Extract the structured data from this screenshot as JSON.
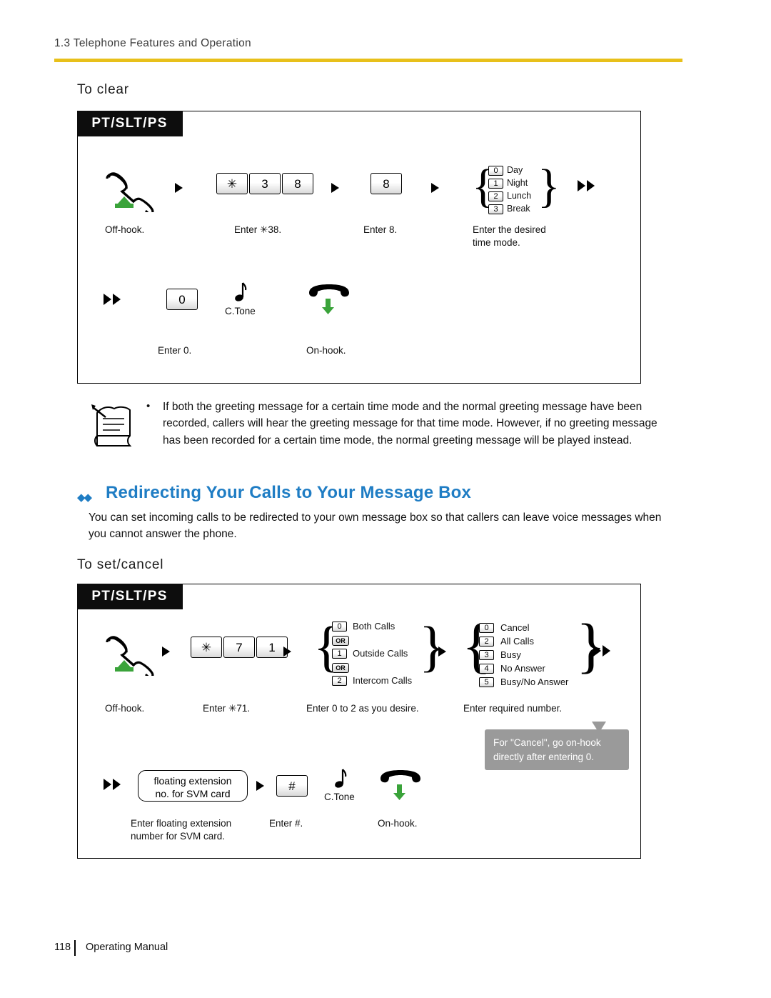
{
  "header": {
    "section": "1.3 Telephone Features and Operation"
  },
  "footer": {
    "page_number": "118",
    "doc_title": "Operating Manual"
  },
  "section1": {
    "heading": "To clear",
    "tab_label": "PT/SLT/PS",
    "steps": [
      {
        "caption": "Off-hook."
      },
      {
        "keys": [
          "✳",
          "3",
          "8"
        ],
        "caption": "Enter ✳38."
      },
      {
        "keys": [
          "8"
        ],
        "caption": "Enter 8."
      },
      {
        "caption": "Enter the desired\ntime mode."
      },
      {
        "keys": [
          "0"
        ],
        "caption": "Enter 0."
      },
      {
        "caption": "On-hook."
      }
    ],
    "time_modes": [
      {
        "key": "0",
        "label": "Day"
      },
      {
        "key": "1",
        "label": "Night"
      },
      {
        "key": "2",
        "label": "Lunch"
      },
      {
        "key": "3",
        "label": "Break"
      }
    ],
    "ctone_label": "C.Tone"
  },
  "note": {
    "bullet": "•",
    "text": "If both the greeting message for a certain time mode and the normal greeting message have been recorded, callers will hear the greeting message for that time mode. However, if no greeting message has been recorded for a certain time mode, the normal greeting message will be played instead."
  },
  "feature": {
    "diamonds": "◆◆",
    "title": "Redirecting Your Calls to Your Message Box",
    "description": "You can set incoming calls to be redirected to your own message box so that callers can leave voice messages when you cannot answer the phone."
  },
  "section2": {
    "heading": "To set/cancel",
    "tab_label": "PT/SLT/PS",
    "steps": [
      {
        "caption": "Off-hook."
      },
      {
        "keys": [
          "✳",
          "7",
          "1"
        ],
        "caption": "Enter ✳71."
      },
      {
        "caption": "Enter 0 to 2 as you desire."
      },
      {
        "caption": "Enter required number."
      },
      {
        "caption": "Enter floating extension\nnumber for SVM card."
      },
      {
        "keys": [
          "#"
        ],
        "caption": "Enter #."
      },
      {
        "caption": "On-hook."
      }
    ],
    "call_types": [
      {
        "key": "0",
        "label": "Both Calls"
      },
      {
        "sep": "OR"
      },
      {
        "key": "1",
        "label": "Outside Calls"
      },
      {
        "sep": "OR"
      },
      {
        "key": "2",
        "label": "Intercom Calls"
      }
    ],
    "required_numbers": [
      {
        "key": "0",
        "label": "Cancel"
      },
      {
        "key": "2",
        "label": "All Calls"
      },
      {
        "key": "3",
        "label": "Busy"
      },
      {
        "key": "4",
        "label": "No Answer"
      },
      {
        "key": "5",
        "label": "Busy/No Answer"
      }
    ],
    "bubble_text": "For \"Cancel\", go on-hook\ndirectly after entering 0.",
    "floating_box": "floating extension\nno. for SVM card",
    "ctone_label": "C.Tone"
  },
  "colors": {
    "accent_rule": "#e8c01a",
    "heading_blue": "#1f7dc4",
    "tab_bg": "#0d0d0d",
    "bubble_bg": "#9a9a9a"
  }
}
